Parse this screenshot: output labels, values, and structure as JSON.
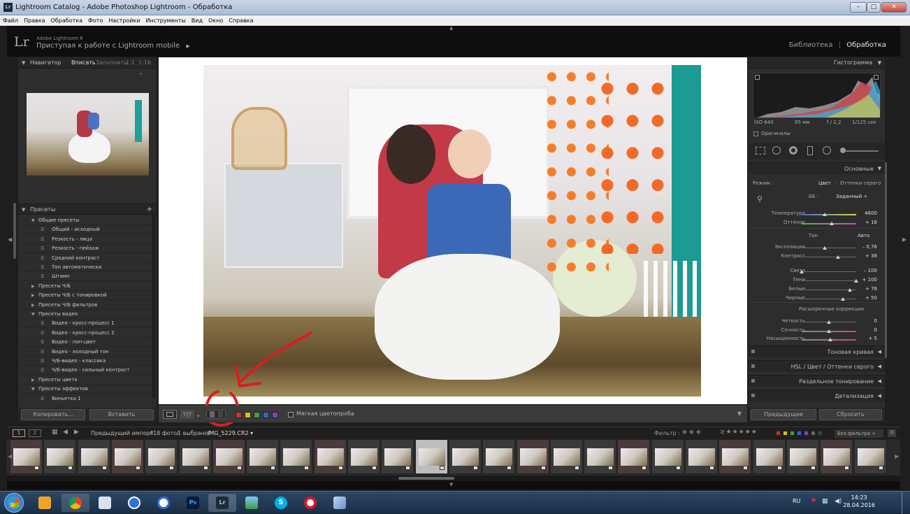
{
  "window": {
    "title": "Lightroom Catalog - Adobe Photoshop Lightroom - Обработка",
    "minimize": "–",
    "maximize": "□",
    "close": "✕"
  },
  "menu": [
    "Файл",
    "Правка",
    "Обработка",
    "Фото",
    "Настройки",
    "Инструменты",
    "Вид",
    "Окно",
    "Справка"
  ],
  "header": {
    "logo": "Lr",
    "product": "Adobe Lightroom 6",
    "identity": "Приступая к работе с Lightroom mobile",
    "modules": [
      "Библиотека",
      "Обработка"
    ],
    "active_module": "Обработка"
  },
  "navigator": {
    "title": "Навигатор",
    "zoom_options": [
      "Вписать",
      "Заполнить",
      "1:1",
      "1:16 ÷"
    ]
  },
  "presets": {
    "title": "Пресеты",
    "rows": [
      {
        "label": "Общие пресеты",
        "level": 0,
        "expanded": true
      },
      {
        "label": "Общий - исходный",
        "level": 1
      },
      {
        "label": "Резкость - лица",
        "level": 1
      },
      {
        "label": "Резкость - пейзаж",
        "level": 1
      },
      {
        "label": "Средний контраст",
        "level": 1
      },
      {
        "label": "Тон автоматически",
        "level": 1
      },
      {
        "label": "Штамп",
        "level": 1
      },
      {
        "label": "Пресеты Ч/Б",
        "level": 0,
        "expanded": false
      },
      {
        "label": "Пресеты Ч/Б с тонировкой",
        "level": 0,
        "expanded": false
      },
      {
        "label": "Пресеты Ч/Б фильтров",
        "level": 0,
        "expanded": false
      },
      {
        "label": "Пресеты видео",
        "level": 0,
        "expanded": true
      },
      {
        "label": "Видео - кросс-процесс 1",
        "level": 1
      },
      {
        "label": "Видео - кросс-процесс 2",
        "level": 1
      },
      {
        "label": "Видео - поп-цвет",
        "level": 1
      },
      {
        "label": "Видео - холодный тон",
        "level": 1
      },
      {
        "label": "Ч/Б-видео - классика",
        "level": 1
      },
      {
        "label": "Ч/Б-видео - сильный контраст",
        "level": 1
      },
      {
        "label": "Пресеты цвета",
        "level": 0,
        "expanded": false
      },
      {
        "label": "Пресеты эффектов",
        "level": 0,
        "expanded": true
      },
      {
        "label": "Виньетка 1",
        "level": 1
      }
    ],
    "copy_button": "Копировать...",
    "paste_button": "Вставить"
  },
  "toolbar": {
    "softproof_label": "Мягкая цветопроба",
    "label_colors": [
      "#c0392b",
      "#d4c21a",
      "#3aa043",
      "#2f67c4",
      "#7d45b8"
    ]
  },
  "histogram": {
    "title": "Гистограмма",
    "iso": "ISO 640",
    "focal": "85 мм",
    "aperture": "f / 2,2",
    "shutter": "1/125 сек",
    "originals": "Оригиналы"
  },
  "basic": {
    "title": "Основные",
    "mode_label": "Режим :",
    "mode_color": "Цвет",
    "mode_bw": "Оттенки серого",
    "wb_label": "ББ :",
    "wb_value": "Заданный ÷",
    "tone_label": "Тон",
    "auto_label": "Авто",
    "presence_label": "Расширенные коррекции",
    "sliders": [
      {
        "label": "Температура",
        "value": "4600",
        "pos": 0.42
      },
      {
        "label": "Оттенок",
        "value": "+ 16",
        "pos": 0.55
      },
      {
        "label": "Экспозиция",
        "value": "– 0,76",
        "pos": 0.42
      },
      {
        "label": "Контраст",
        "value": "+ 38",
        "pos": 0.67
      },
      {
        "label": "Света",
        "value": "– 100",
        "pos": 0.0
      },
      {
        "label": "Тени",
        "value": "+ 100",
        "pos": 1.0
      },
      {
        "label": "Белые",
        "value": "+ 76",
        "pos": 0.88
      },
      {
        "label": "Черные",
        "value": "+ 50",
        "pos": 0.75
      },
      {
        "label": "Четкость",
        "value": "0",
        "pos": 0.5
      },
      {
        "label": "Сочность",
        "value": "0",
        "pos": 0.5
      },
      {
        "label": "Насыщенность",
        "value": "+ 5",
        "pos": 0.52
      }
    ]
  },
  "right_sections": [
    {
      "label": "Тоновая кривая"
    },
    {
      "label": "HSL  /  Цвет  /  Оттенки серого"
    },
    {
      "label": "Раздельное тонирование"
    },
    {
      "label": "Детализация"
    }
  ],
  "right_buttons": {
    "previous": "Предыдущие",
    "reset": "Сбросить"
  },
  "filmstrip": {
    "source": "Предыдущий импорт",
    "count": "418 фото/",
    "selected": "1 выбрано/",
    "filename": "IMG_5229.CR2 ▾",
    "filter_label": "Фильтр :",
    "filter_value": "Без фильтра ÷",
    "views": [
      "1",
      "2"
    ],
    "thumb_count": 26,
    "selected_index": 12
  },
  "taskbar": {
    "lang": "RU",
    "time": "14:23",
    "date": "28.04.2016"
  }
}
